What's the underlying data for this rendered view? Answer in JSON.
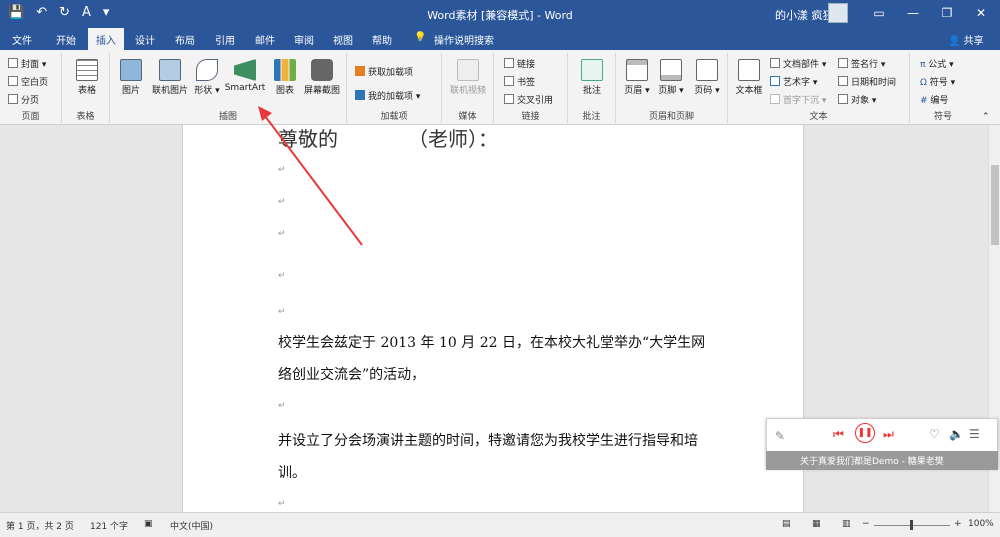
{
  "titlebar": {
    "title": "Word素材 [兼容模式] - Word",
    "user": "的小漾 疯狂"
  },
  "tabs": [
    "文件",
    "开始",
    "插入",
    "设计",
    "布局",
    "引用",
    "邮件",
    "审阅",
    "视图",
    "帮助",
    "操作说明搜索"
  ],
  "active_tab": "插入",
  "share": "共享",
  "ribbon": {
    "pages": {
      "label": "页面",
      "items": [
        "封面",
        "空白页",
        "分页"
      ]
    },
    "tables": {
      "label": "表格",
      "items": [
        "表格"
      ]
    },
    "illus": {
      "label": "插图",
      "items": [
        "图片",
        "联机图片",
        "形状",
        "SmartArt",
        "图表",
        "屏幕截图"
      ]
    },
    "addins": {
      "label": "加载项",
      "items": [
        "获取加载项",
        "我的加载项"
      ]
    },
    "media": {
      "label": "媒体",
      "items": [
        "联机视频"
      ]
    },
    "links": {
      "label": "链接",
      "items": [
        "链接",
        "书签",
        "交叉引用"
      ]
    },
    "comments": {
      "label": "批注",
      "items": [
        "批注"
      ]
    },
    "hf": {
      "label": "页眉和页脚",
      "items": [
        "页眉",
        "页脚",
        "页码"
      ]
    },
    "text": {
      "label": "文本",
      "items": [
        "文本框",
        "文档部件",
        "艺术字",
        "首字下沉",
        "签名行",
        "日期和时间",
        "对象"
      ]
    },
    "symbols": {
      "label": "符号",
      "items": [
        "公式",
        "符号",
        "编号"
      ]
    }
  },
  "doc": {
    "heading": "尊敬的　　　　（老师）：",
    "p1a": "校学生会兹定于 2013 年 10 月 22 日，在本校大礼堂举办“大学生网",
    "p1b": "络创业交流会”的活动，",
    "p2a": "并设立了分会场演讲主题的时间，特邀请您为我校学生进行指导和培",
    "p2b": "训。"
  },
  "status": {
    "page": "第 1 页，共 2 页",
    "words": "121 个字",
    "lang": "中文(中国)",
    "zoom": "100%"
  },
  "music": {
    "song": "关于真爱我们都是Demo - 糖果老樊"
  }
}
